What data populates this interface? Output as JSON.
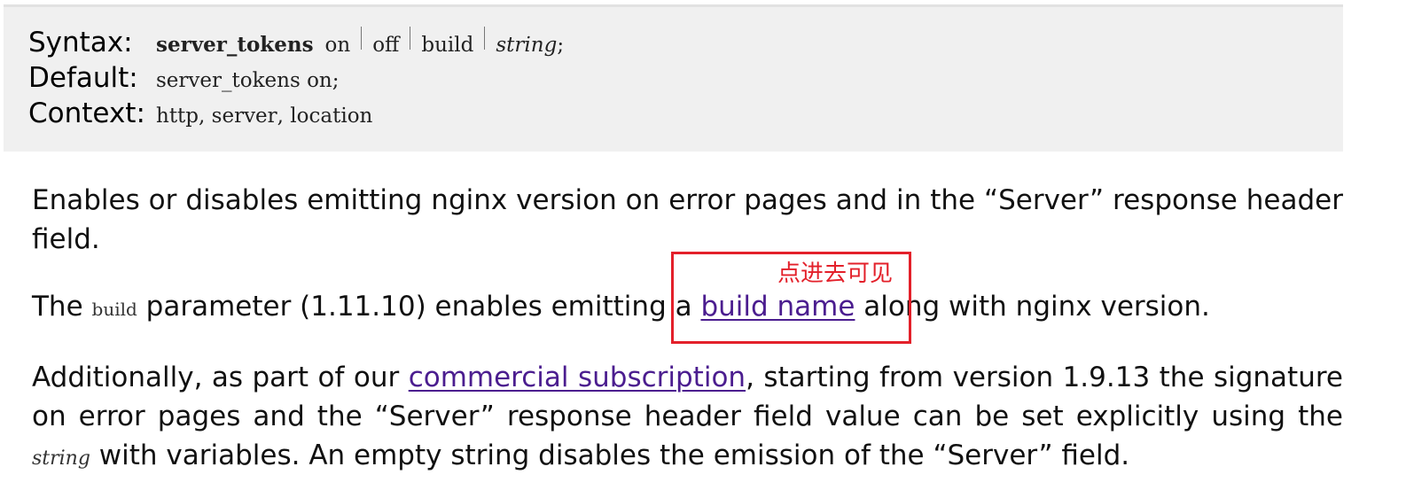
{
  "directive": {
    "syntax_label": "Syntax:",
    "syntax_name": "server_tokens",
    "syntax_options": [
      "on",
      "off",
      "build"
    ],
    "syntax_string": "string",
    "syntax_end": ";",
    "default_label": "Default:",
    "default_value": "server_tokens on;",
    "context_label": "Context:",
    "context_items": [
      "http",
      "server",
      "location"
    ],
    "context_sep": ", "
  },
  "para1": {
    "text": "Enables or disables emitting nginx version on error pages and in the “Server” response header field."
  },
  "para2": {
    "prefix": "The ",
    "code": "build",
    "middle": " parameter (1.11.10) enables emitting a ",
    "link": "build name",
    "suffix": " along with nginx version."
  },
  "para3": {
    "prefix": "Additionally, as part of our ",
    "link": "commercial subscription",
    "middle": ", starting from version 1.9.13 the signature on error pages and the “Server” response header field value can be set explicitly using the ",
    "code": "string",
    "suffix": " with variables. An empty string disables the emission of the “Server” field."
  },
  "annotation": {
    "text": "点进去可见",
    "color": "#e3202a"
  },
  "colors": {
    "link": "#4b1d8f",
    "box_bg": "#f0f0f0"
  }
}
